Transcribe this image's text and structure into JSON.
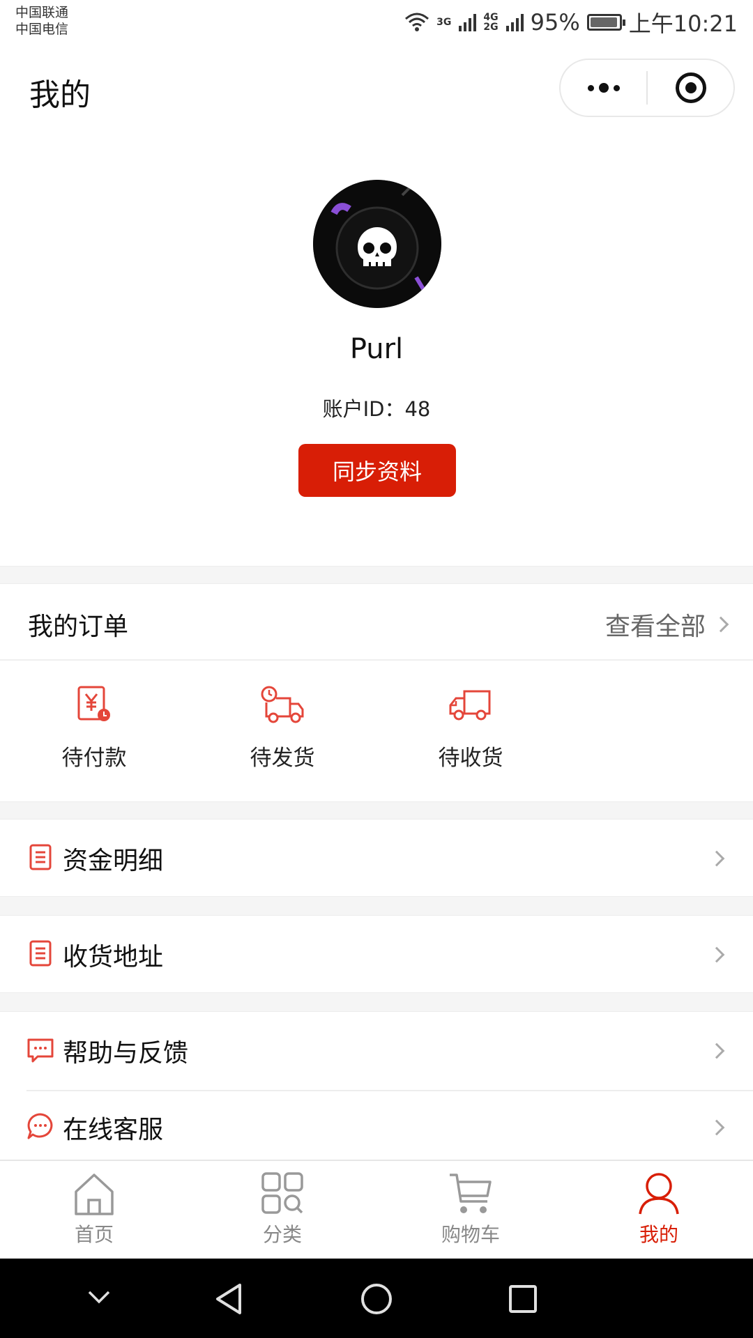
{
  "status_bar": {
    "carrier_1": "中国联通",
    "carrier_2": "中国电信",
    "network_1": "3G",
    "network_2": "4G",
    "network_3": "2G",
    "battery_percent": "95%",
    "battery_level": 0.95,
    "time": "上午10:21"
  },
  "navbar": {
    "title": "我的",
    "more_icon": "more-dots-icon",
    "close_icon": "target-icon"
  },
  "profile": {
    "username": "Purl",
    "account_id": "账户ID：48",
    "sync_button": "同步资料"
  },
  "orders": {
    "title": "我的订单",
    "view_all": "查看全部",
    "items": [
      {
        "label": "待付款",
        "icon": "payment-pending-icon"
      },
      {
        "label": "待发货",
        "icon": "to-ship-truck-icon"
      },
      {
        "label": "待收货",
        "icon": "to-receive-truck-icon"
      }
    ]
  },
  "menu": {
    "funds": "资金明细",
    "address": "收货地址",
    "help": "帮助与反馈",
    "service": "在线客服"
  },
  "tabbar": {
    "items": [
      {
        "label": "首页",
        "icon": "home-icon"
      },
      {
        "label": "分类",
        "icon": "category-icon"
      },
      {
        "label": "购物车",
        "icon": "cart-icon"
      },
      {
        "label": "我的",
        "icon": "user-icon"
      }
    ]
  },
  "colors": {
    "accent": "#d81e06",
    "icon_red": "#e4463a",
    "background_gap": "#f5f5f5"
  }
}
